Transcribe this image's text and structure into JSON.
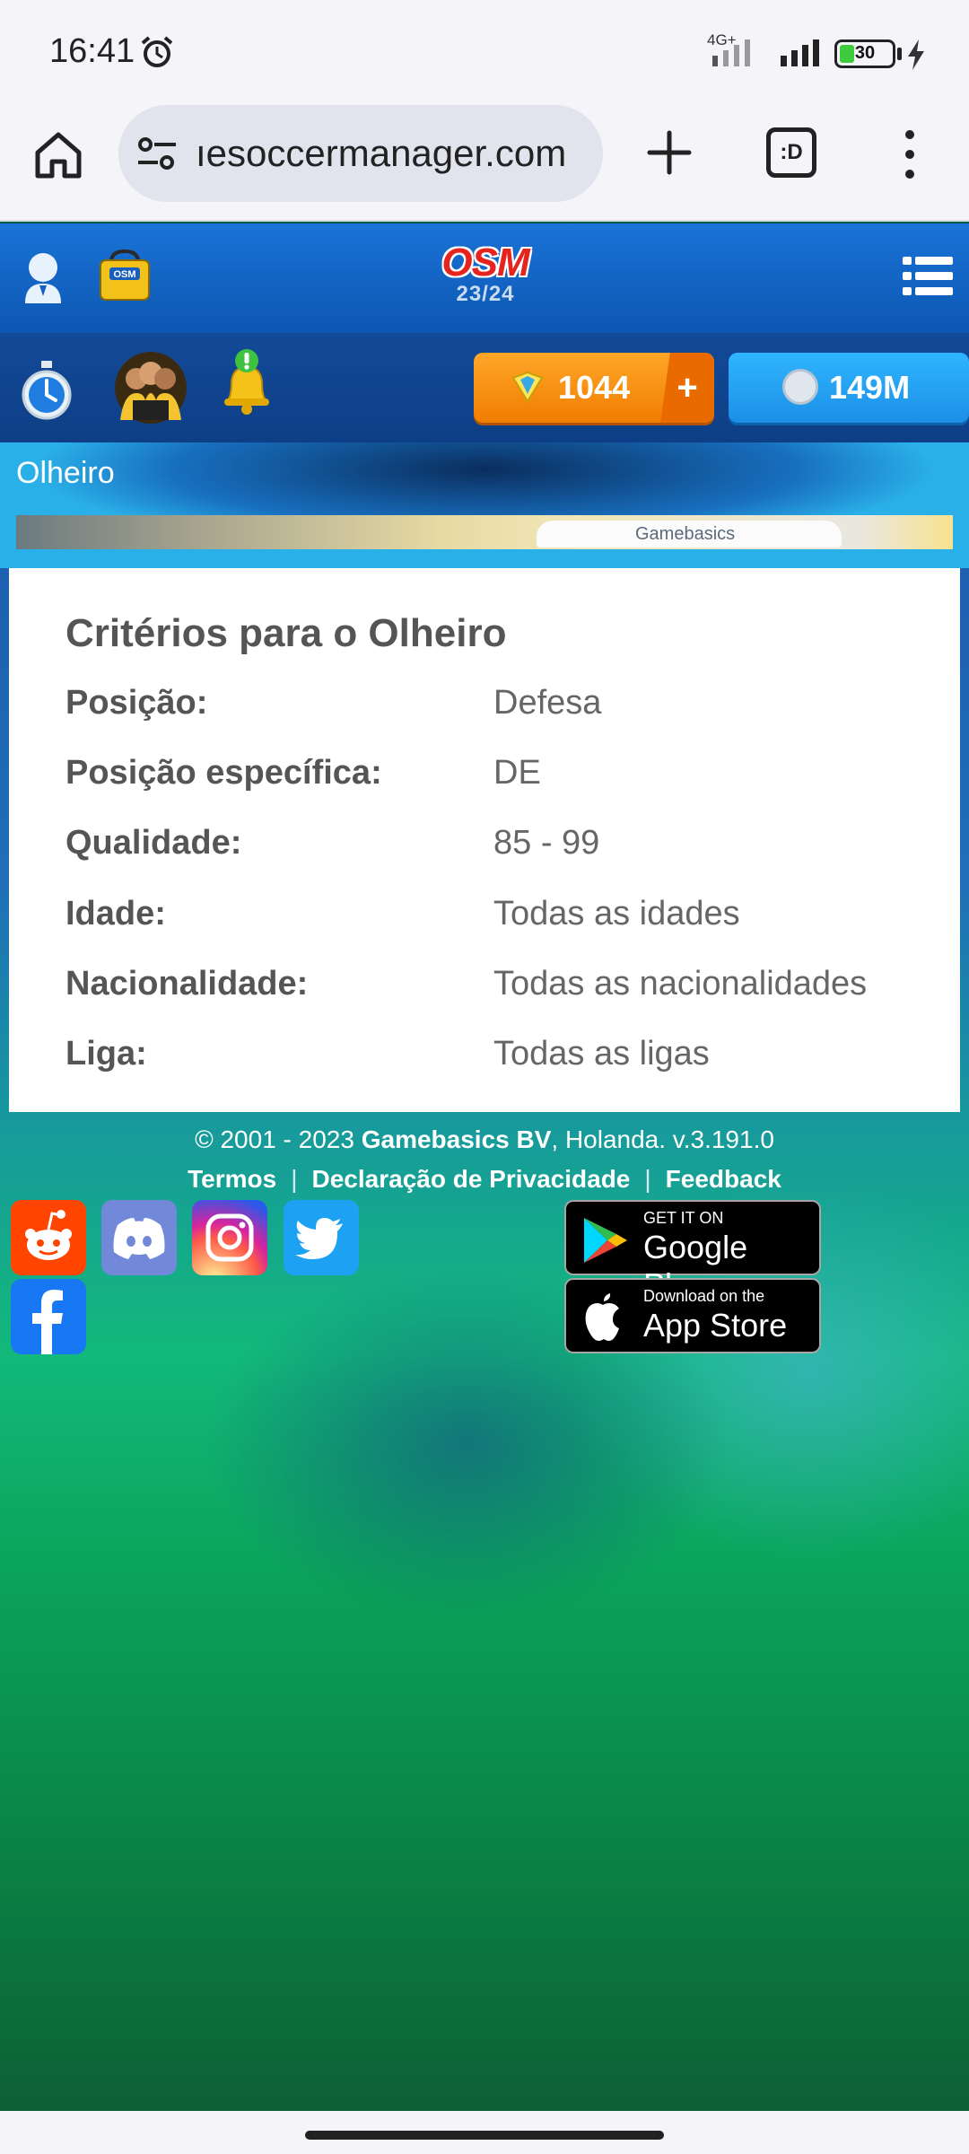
{
  "status": {
    "time": "16:41",
    "network": "4G+",
    "battery": "30"
  },
  "browser": {
    "url": "ıesoccermanager.com",
    "tabs_label": ":D"
  },
  "game": {
    "logo": "OSM",
    "season": "23/24",
    "gems": "1044",
    "gems_add": "+",
    "coins": "149M"
  },
  "page": {
    "title": "Olheiro",
    "banner_text": "Gamebasics"
  },
  "criteria": {
    "heading": "Critérios para o Olheiro",
    "rows": [
      {
        "label": "Posição:",
        "value": "Defesa"
      },
      {
        "label": "Posição específica:",
        "value": "DE"
      },
      {
        "label": "Qualidade:",
        "value": "85 - 99"
      },
      {
        "label": "Idade:",
        "value": "Todas as idades"
      },
      {
        "label": "Nacionalidade:",
        "value": "Todas as nacionalidades"
      },
      {
        "label": "Liga:",
        "value": "Todas as ligas"
      }
    ]
  },
  "footer": {
    "copy_prefix": "© 2001 - 2023 ",
    "company": "Gamebasics BV",
    "copy_suffix": ", Holanda. v.3.191.0",
    "links": [
      "Termos",
      "Declaração de Privacidade",
      "Feedback"
    ],
    "separator": "|",
    "google_play_small": "GET IT ON",
    "google_play_big": "Google Play",
    "app_store_small": "Download on the",
    "app_store_big": "App Store"
  },
  "colors": {
    "brand_blue": "#1a73d6",
    "gem_orange": "#f07d00",
    "coin_blue": "#1b8fe6"
  }
}
